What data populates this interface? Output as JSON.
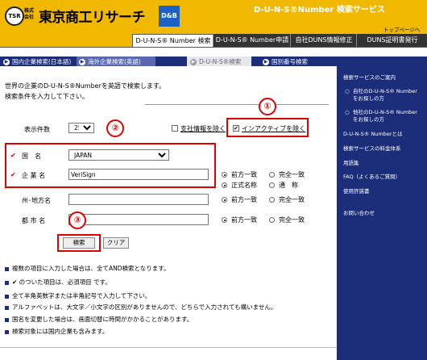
{
  "header": {
    "logo_mark": "TSR",
    "logo_sub": "株式会社",
    "logo_name": "東京商工リサーチ",
    "logo_db": "D&B",
    "service_title": "D-U-N-S®Number 検索サービス",
    "top_link": "トップページへ"
  },
  "main_tabs": [
    {
      "label": "D-U-N-S® Number 検索",
      "active": true
    },
    {
      "label": "D-U-N-S® Number申請",
      "active": false
    },
    {
      "label": "自社DUNS情報修正",
      "active": false
    },
    {
      "label": "DUNS証明書発行",
      "active": false
    }
  ],
  "sub_tabs": [
    {
      "label": "国内企業検索(日本語)"
    },
    {
      "label": "海外企業検索(英語)"
    },
    {
      "label": "D-U-N-S®検索"
    },
    {
      "label": "国別番号検索"
    }
  ],
  "intro": {
    "line1": "世界の企業のD-U-N-S®Numberを英語で検索します。",
    "line2": "検索条件を入力して下さい。"
  },
  "form": {
    "count_label": "表示件数",
    "count_value": "25",
    "branch_label": "支社情報を除く",
    "inactive_label": "インアクティブを除く",
    "country_label": "国　名",
    "country_value": "JAPAN",
    "company_label": "企 業 名",
    "company_value": "VeriSign",
    "state_label": "州･地方名",
    "city_label": "都 市 名",
    "match_prefix": "前方一致",
    "match_full": "完全一致",
    "match_formal": "正式名称",
    "match_alias": "通　称",
    "search_button": "検索",
    "clear_button": "クリア"
  },
  "badges": [
    "①",
    "②",
    "③"
  ],
  "notes": [
    "複数の項目に入力した場合は、全てAND検索となります。",
    "✔ のついた項目は、必須項目 です。",
    "全て半角英数字または半角記号で入力して下さい。",
    "アルファベットは、大文字／小文字の区別がありませんので、どちらで入力されても構いません。",
    "国名を変更した場合は、画面切替に時間がかかることがあります。",
    "検索対象には国内企業も含みます。"
  ],
  "sidebar": {
    "items": [
      "検索サービスのご案内",
      "自社のD-U-N-S® Number",
      "をお探しの方",
      "他社のD-U-N-S® Number",
      "をお探しの方",
      "D-U-N-S® Numberとは",
      "検索サービスの料金体系",
      "用語集",
      "FAQ（よくあるご質問）",
      "使用許諾書",
      "お問い合わせ"
    ]
  },
  "colors": {
    "header_yellow": "#f0b800",
    "nav_blue": "#1c2d7a",
    "highlight_red": "#e00000"
  }
}
